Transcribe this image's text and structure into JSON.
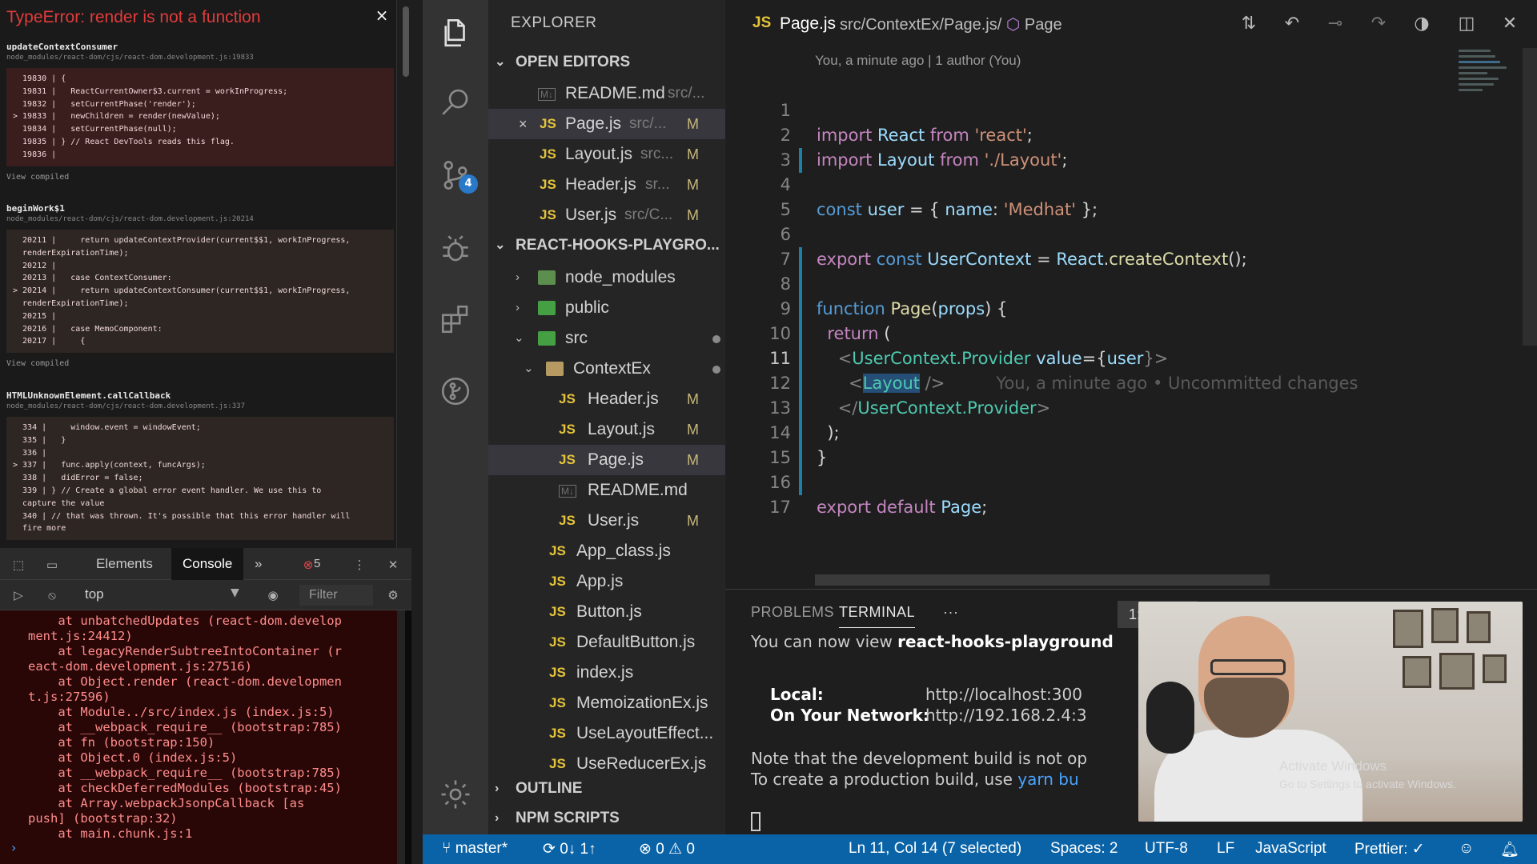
{
  "overlay": {
    "error_title": "TypeError: render is not a function",
    "close_label": "×",
    "frames": [
      {
        "fn": "updateContextConsumer",
        "path": "node_modules/react-dom/cjs/react-dom.development.js:19833",
        "lines": [
          "  19830 | {",
          "  19831 |   ReactCurrentOwner$3.current = workInProgress;",
          "  19832 |   setCurrentPhase('render');",
          "> 19833 |   newChildren = render(newValue);",
          "  19834 |   setCurrentPhase(null);",
          "  19835 | } // React DevTools reads this flag.",
          "  19836 |"
        ],
        "view": "View compiled"
      },
      {
        "fn": "beginWork$1",
        "path": "node_modules/react-dom/cjs/react-dom.development.js:20214",
        "lines": [
          "  20211 |     return updateContextProvider(current$$1, workInProgress,",
          "  renderExpirationTime);",
          "  20212 |",
          "  20213 |   case ContextConsumer:",
          "> 20214 |     return updateContextConsumer(current$$1, workInProgress,",
          "  renderExpirationTime);",
          "  20215 |",
          "  20216 |   case MemoComponent:",
          "  20217 |     {"
        ],
        "view": "View compiled"
      },
      {
        "fn": "HTMLUnknownElement.callCallback",
        "path": "node_modules/react-dom/cjs/react-dom.development.js:337",
        "lines": [
          "  334 |     window.event = windowEvent;",
          "  335 |   }",
          "  336 |",
          "> 337 |   func.apply(context, funcArgs);",
          "  338 |   didError = false;",
          "  339 | } // Create a global error event handler. We use this to",
          "  capture the value",
          "  340 | // that was thrown. It's possible that this error handler will",
          "  fire more"
        ]
      }
    ]
  },
  "devtools": {
    "tabs": [
      "Elements",
      "Console"
    ],
    "active_tab": "Console",
    "more": "»",
    "error_count": "5",
    "context": "top",
    "filter_placeholder": "Filter",
    "console_lines": [
      "    at unbatchedUpdates (react-dom.develop",
      "ment.js:24412)",
      "    at legacyRenderSubtreeIntoContainer (r",
      "eact-dom.development.js:27516)",
      "    at Object.render (react-dom.developmen",
      "t.js:27596)",
      "    at Module../src/index.js (index.js:5)",
      "    at __webpack_require__ (bootstrap:785)",
      "    at fn (bootstrap:150)",
      "    at Object.0 (index.js:5)",
      "    at __webpack_require__ (bootstrap:785)",
      "    at checkDeferredModules (bootstrap:45)",
      "    at Array.webpackJsonpCallback [as",
      "push] (bootstrap:32)",
      "    at main.chunk.js:1"
    ],
    "prompt": "›"
  },
  "explorer": {
    "title": "EXPLORER",
    "open_editors_label": "OPEN EDITORS",
    "open_editors": [
      {
        "icon": "markdown-icon",
        "name": "README.md",
        "dir": "src/...",
        "status": ""
      },
      {
        "icon": "js-icon",
        "name": "Page.js",
        "dir": "src/...",
        "status": "M",
        "selected": true,
        "close": "×"
      },
      {
        "icon": "js-icon",
        "name": "Layout.js",
        "dir": "src...",
        "status": "M"
      },
      {
        "icon": "js-icon",
        "name": "Header.js",
        "dir": "sr...",
        "status": "M"
      },
      {
        "icon": "js-icon",
        "name": "User.js",
        "dir": "src/C...",
        "status": "M"
      }
    ],
    "project_label": "REACT-HOOKS-PLAYGRO...",
    "tree": [
      {
        "name": "node_modules",
        "type": "folder",
        "depth": 1,
        "arrow": "›"
      },
      {
        "name": "public",
        "type": "folder",
        "depth": 1,
        "arrow": "›"
      },
      {
        "name": "src",
        "type": "folder",
        "depth": 1,
        "arrow": "⌄",
        "dot": true
      },
      {
        "name": "ContextEx",
        "type": "folder",
        "depth": 2,
        "arrow": "⌄",
        "dot": true
      },
      {
        "name": "Header.js",
        "type": "js",
        "depth": 3,
        "status": "M"
      },
      {
        "name": "Layout.js",
        "type": "js",
        "depth": 3,
        "status": "M"
      },
      {
        "name": "Page.js",
        "type": "js",
        "depth": 3,
        "status": "M",
        "selected": true
      },
      {
        "name": "README.md",
        "type": "md",
        "depth": 3
      },
      {
        "name": "User.js",
        "type": "js",
        "depth": 3,
        "status": "M"
      },
      {
        "name": "App_class.js",
        "type": "js",
        "depth": 2
      },
      {
        "name": "App.js",
        "type": "js",
        "depth": 2
      },
      {
        "name": "Button.js",
        "type": "js",
        "depth": 2
      },
      {
        "name": "DefaultButton.js",
        "type": "js",
        "depth": 2
      },
      {
        "name": "index.js",
        "type": "js",
        "depth": 2
      },
      {
        "name": "MemoizationEx.js",
        "type": "js",
        "depth": 2
      },
      {
        "name": "UseLayoutEffect...",
        "type": "js",
        "depth": 2
      },
      {
        "name": "UseReducerEx.js",
        "type": "js",
        "depth": 2
      }
    ],
    "outline_label": "OUTLINE",
    "npm_label": "NPM SCRIPTS",
    "js_label": "JS",
    "md_label": "M↓"
  },
  "activity_bar": {
    "scm_badge": "4"
  },
  "editor": {
    "tab_js": "JS",
    "tab_name": "Page.js",
    "tab_crumb": "src/ContextEx/Page.js/",
    "crumb_symbol": "Page",
    "blame": "You, a minute ago | 1 author (You)",
    "lines": [
      "1",
      "2",
      "3",
      "4",
      "5",
      "6",
      "7",
      "8",
      "9",
      "10",
      "11",
      "12",
      "13",
      "14",
      "15",
      "16",
      "17"
    ],
    "code": {
      "l1_a": "import",
      "l1_b": " React ",
      "l1_c": "from",
      "l1_d": " 'react'",
      "l1_e": ";",
      "l2_a": "import",
      "l2_b": " Layout ",
      "l2_c": "from",
      "l2_d": " './Layout'",
      "l2_e": ";",
      "l4_a": "const",
      "l4_b": " user ",
      "l4_c": "= { ",
      "l4_d": "name",
      "l4_e": ": ",
      "l4_f": "'Medhat'",
      "l4_g": " };",
      "l6_a": "export",
      "l6_b": " const ",
      "l6_c": "UserContext",
      "l6_d": " = ",
      "l6_e": "React",
      "l6_f": ".",
      "l6_g": "createContext",
      "l6_h": "();",
      "l8_a": "function",
      "l8_b": " Page",
      "l8_c": "(",
      "l8_d": "props",
      "l8_e": ") {",
      "l9_a": "  return",
      "l9_b": " (",
      "l10_a": "    <",
      "l10_b": "UserContext.Provider",
      "l10_c": " value",
      "l10_d": "={",
      "l10_e": "user",
      "l10_f": "}>",
      "l11_a": "      <",
      "l11_b": "Layout",
      "l11_c": " />",
      "l11_ghost": "You, a minute ago • Uncommitted changes",
      "l12_a": "    </",
      "l12_b": "UserContext.Provider",
      "l12_c": ">",
      "l13_a": "  );",
      "l14_a": "}",
      "l16_a": "export",
      "l16_b": " default ",
      "l16_c": "Page",
      "l16_d": ";"
    }
  },
  "panel": {
    "tabs": [
      "PROBLEMS",
      "TERMINAL"
    ],
    "active_tab": "TERMINAL",
    "more": "···",
    "terminal_select": "1: node",
    "terminal": {
      "line1_a": "You can now view ",
      "line1_b": "react-hooks-playground",
      "local_label": "Local:",
      "local_url": "http://localhost:300",
      "network_label": "On Your Network:",
      "network_url": "http://192.168.2.4:3",
      "note1": "Note that the development build is not op",
      "note2_a": "To create a production build, use ",
      "note2_b": "yarn bu"
    }
  },
  "watermark": {
    "line1": "Activate Windows",
    "line2": "Go to Settings to activate Windows."
  },
  "status": {
    "branch": "master*",
    "sync": "0↓ 1↑",
    "errors": "0",
    "warnings": "0",
    "position": "Ln 11, Col 14 (7 selected)",
    "spaces": "Spaces: 2",
    "encoding": "UTF-8",
    "eol": "LF",
    "language": "JavaScript",
    "prettier": "Prettier: ✓"
  }
}
